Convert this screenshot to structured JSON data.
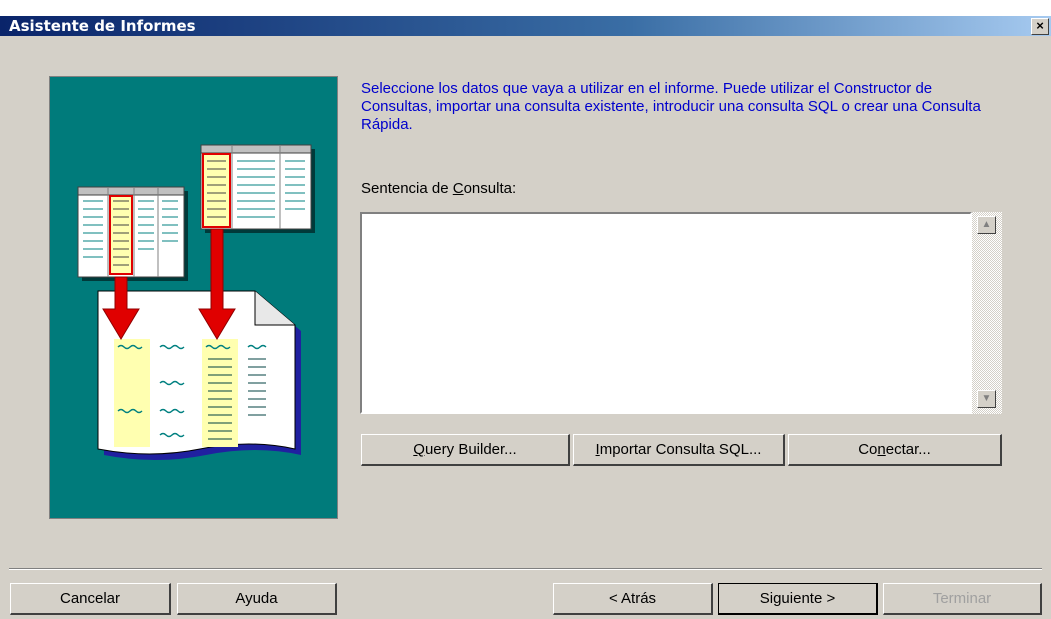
{
  "window": {
    "title": "Asistente de Informes",
    "close_glyph": "×"
  },
  "instructions": "Seleccione los datos que vaya a utilizar en el informe. Puede utilizar el Constructor de Consultas, importar una consulta existente, introducir una consulta SQL o crear una Consulta Rápida.",
  "query": {
    "label_before": "Sentencia de ",
    "label_accel": "C",
    "label_after": "onsulta:",
    "value": ""
  },
  "scrollbar": {
    "up_icon": "▲",
    "down_icon": "▼"
  },
  "query_buttons": {
    "query_builder": {
      "accel": "Q",
      "rest": "uery Builder..."
    },
    "import_sql": {
      "accel": "I",
      "rest": "mportar Consulta SQL..."
    },
    "connect": {
      "before": "Co",
      "accel": "n",
      "after": "ectar..."
    }
  },
  "footer_buttons": {
    "cancel": "Cancelar",
    "help": "Ayuda",
    "back": "< Atrás",
    "next": "Siguiente >",
    "finish": "Terminar"
  },
  "colors": {
    "dialog_bg": "#d4d0c8",
    "art_bg": "#007b7b",
    "instruction_text": "#0000cc",
    "arrow_red": "#e00000"
  },
  "icons": {
    "illustration": "query-tables-to-report-illustration"
  }
}
